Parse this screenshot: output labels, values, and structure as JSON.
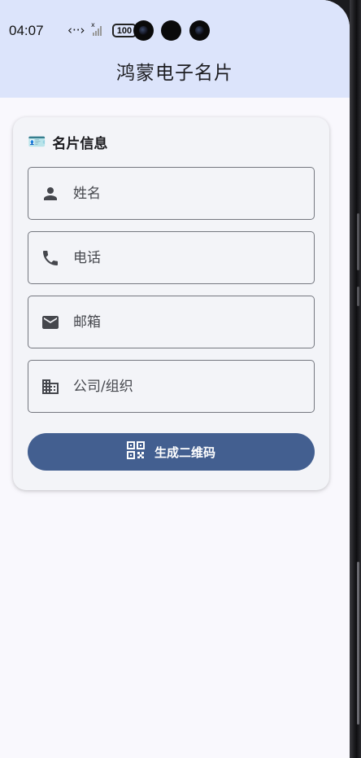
{
  "status_bar": {
    "time": "04:07",
    "network_glyph": "‹··›",
    "battery": "100"
  },
  "app": {
    "title": "鸿蒙电子名片"
  },
  "card": {
    "header_icon": "🪪",
    "header": "名片信息",
    "fields": [
      {
        "icon": "person-icon",
        "placeholder": "姓名",
        "value": ""
      },
      {
        "icon": "phone-icon",
        "placeholder": "电话",
        "value": ""
      },
      {
        "icon": "mail-icon",
        "placeholder": "邮箱",
        "value": ""
      },
      {
        "icon": "business-icon",
        "placeholder": "公司/组织",
        "value": ""
      }
    ],
    "generate_button": {
      "icon": "qr-code-icon",
      "label": "生成二维码",
      "color": "#435f90"
    }
  },
  "colors": {
    "header_bg": "#dce4fb",
    "page_bg": "#f9f8fd",
    "card_bg": "#f3f4f8",
    "icon": "#45474d"
  }
}
